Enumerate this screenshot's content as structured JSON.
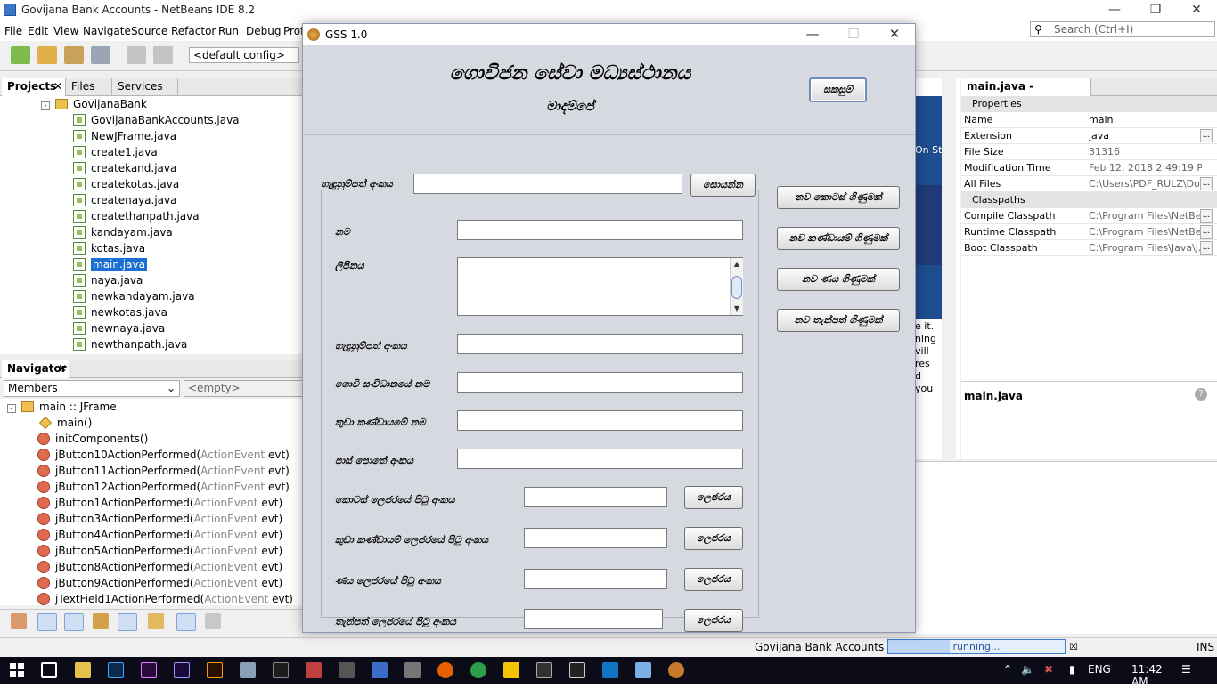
{
  "ide": {
    "title": "Govijana Bank Accounts - NetBeans IDE 8.2",
    "menu": [
      "File",
      "Edit",
      "View",
      "Navigate",
      "Source",
      "Refactor",
      "Run",
      "Debug",
      "Prof"
    ],
    "config": "<default config>",
    "search_placeholder": "Search (Ctrl+I)",
    "project_tabs": [
      "Projects",
      "Files",
      "Services"
    ],
    "package": "GovijanaBank",
    "files": [
      "GovijanaBankAccounts.java",
      "NewJFrame.java",
      "create1.java",
      "createkand.java",
      "createkotas.java",
      "createnaya.java",
      "createthanpath.java",
      "kandayam.java",
      "kotas.java",
      "main.java",
      "naya.java",
      "newkandayam.java",
      "newkotas.java",
      "newnaya.java",
      "newthanpath.java"
    ],
    "selected_file": "main.java",
    "navigator_tab": "Navigator",
    "members_select": "Members",
    "filter_placeholder": "<empty>",
    "nav_root": "main :: JFrame",
    "nav_items": [
      {
        "name": "main()",
        "param": ""
      },
      {
        "name": "initComponents()",
        "param": ""
      },
      {
        "name": "jButton10ActionPerformed(",
        "param": "ActionEvent",
        "tail": " evt)"
      },
      {
        "name": "jButton11ActionPerformed(",
        "param": "ActionEvent",
        "tail": " evt)"
      },
      {
        "name": "jButton12ActionPerformed(",
        "param": "ActionEvent",
        "tail": " evt)"
      },
      {
        "name": "jButton1ActionPerformed(",
        "param": "ActionEvent",
        "tail": " evt)"
      },
      {
        "name": "jButton3ActionPerformed(",
        "param": "ActionEvent",
        "tail": " evt)"
      },
      {
        "name": "jButton4ActionPerformed(",
        "param": "ActionEvent",
        "tail": " evt)"
      },
      {
        "name": "jButton5ActionPerformed(",
        "param": "ActionEvent",
        "tail": " evt)"
      },
      {
        "name": "jButton8ActionPerformed(",
        "param": "ActionEvent",
        "tail": " evt)"
      },
      {
        "name": "jButton9ActionPerformed(",
        "param": "ActionEvent",
        "tail": " evt)"
      },
      {
        "name": "jTextField1ActionPerformed(",
        "param": "ActionEvent",
        "tail": " evt)"
      }
    ],
    "properties_tab": "main.java - Properties",
    "props_section": "Properties",
    "props": [
      {
        "k": "Name",
        "v": "main",
        "dark": true,
        "dots": false
      },
      {
        "k": "Extension",
        "v": "java",
        "dark": true,
        "dots": true
      },
      {
        "k": "File Size",
        "v": "31316",
        "dark": false,
        "dots": false
      },
      {
        "k": "Modification Time",
        "v": "Feb 12, 2018 2:49:19 PM",
        "dark": false,
        "dots": false
      },
      {
        "k": "All Files",
        "v": "C:\\Users\\PDF_RULZ\\Do...",
        "dark": false,
        "dots": true
      }
    ],
    "classpaths_section": "Classpaths",
    "classpaths": [
      {
        "k": "Compile Classpath",
        "v": "C:\\Program Files\\NetBe..."
      },
      {
        "k": "Runtime Classpath",
        "v": "C:\\Program Files\\NetBe..."
      },
      {
        "k": "Boot Classpath",
        "v": "C:\\Program Files\\Java\\j..."
      }
    ],
    "prop_desc_title": "main.java",
    "peek_banner_text": "On Sta",
    "peek_text": [
      "e it.",
      "ning",
      "vill",
      "res",
      "d",
      "you"
    ],
    "status_project": "Govijana Bank Accounts (run)",
    "status_running": "running...",
    "status_ins": "INS"
  },
  "dialog": {
    "title": "GSS 1.0",
    "heading": "ගොවිජන සේවා මධ්‍යස්ථානය",
    "subheading": "මාදම්පේ",
    "save_btn": "සකසුම්",
    "id_label": "හැඳුනුම්පත් අංකය",
    "search_btn": "සොයන්න",
    "side_buttons": [
      "නව කොටස් ගිණුමක්",
      "නව කණ්ඩායම් ගිණුමක්",
      "නව ණය ගිණුමක්",
      "නව තැන්පත් ගිණුමක්"
    ],
    "field_labels": {
      "name": "නම",
      "address": "ලිපිනය",
      "nic": "හැඳුනුම්පත් අංකය",
      "org": "ගොවි සංවිධානයේ නම",
      "group": "කුඩා කණ්ඩායමේ නම",
      "passbook": "පාස් පොතේ අංකය"
    },
    "ledger_rows": [
      {
        "label": "කොටස් ලෙජරයේ පිටු අංකය",
        "btn": "ලෙජරය"
      },
      {
        "label": "කුඩා කණ්ඩායම් ලෙජරයේ පිටු අංකය",
        "btn": "ලෙජරය"
      },
      {
        "label": "ණය ලෙජරයේ පිටු අංකය",
        "btn": "ලෙජරය"
      },
      {
        "label": "තැන්පත් ලෙජරයේ පිටු අංකය",
        "btn": "ලෙජරය"
      }
    ]
  },
  "taskbar": {
    "lang": "ENG",
    "time": "11:42 AM"
  },
  "progress": 0.35
}
